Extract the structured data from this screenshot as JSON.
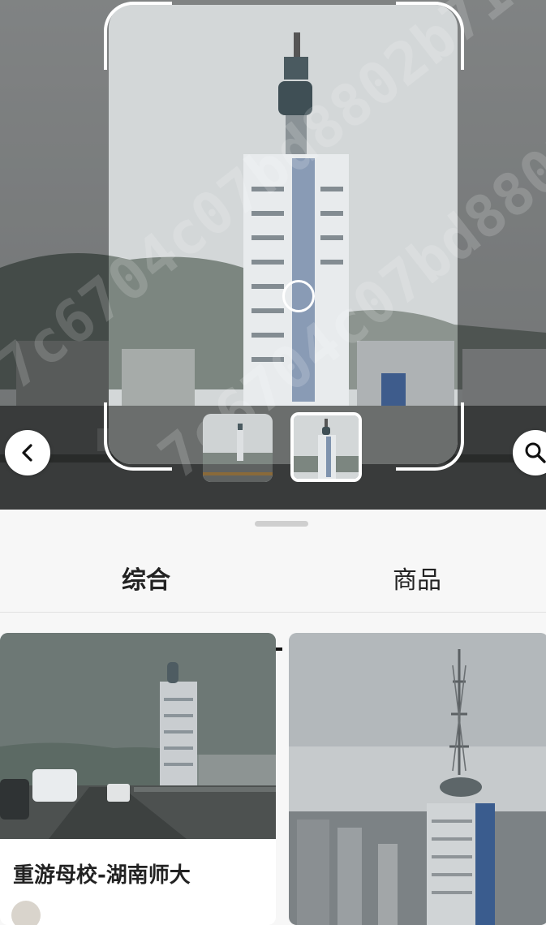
{
  "viewer": {
    "back_icon": "chevron-left-icon",
    "search_icon": "search-icon",
    "watermark_text": "7c6704c07bd8802b71"
  },
  "results": {
    "tabs": [
      {
        "label": "综合",
        "active": true
      },
      {
        "label": "商品",
        "active": false
      }
    ],
    "cards": [
      {
        "title": "重游母校-湖南师大"
      },
      {
        "title": ""
      }
    ]
  },
  "colors": {
    "panel_bg": "#f7f7f7",
    "active_tab_underline": "#111111",
    "frame": "#ffffff"
  }
}
